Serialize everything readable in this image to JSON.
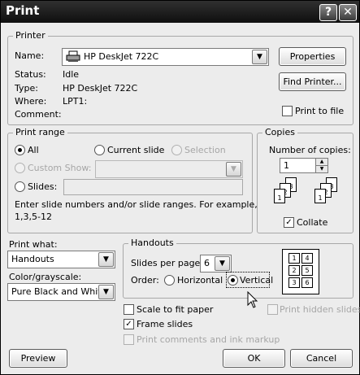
{
  "window": {
    "title": "Print",
    "help_btn": "?",
    "close_btn": "✕"
  },
  "printer": {
    "group_label": "Printer",
    "name_label": "Name:",
    "name_value": "HP DeskJet 722C",
    "properties_btn": "Properties",
    "find_printer_btn": "Find Printer...",
    "status_label": "Status:",
    "status_value": "Idle",
    "type_label": "Type:",
    "type_value": "HP DeskJet 722C",
    "where_label": "Where:",
    "where_value": "LPT1:",
    "comment_label": "Comment:",
    "comment_value": "",
    "print_to_file": "Print to file"
  },
  "print_range": {
    "group_label": "Print range",
    "all": "All",
    "current_slide": "Current slide",
    "selection": "Selection",
    "custom_show": "Custom Show:",
    "slides": "Slides:",
    "hint": "Enter slide numbers and/or slide ranges. For example,",
    "hint_example": "1,3,5-12"
  },
  "copies": {
    "group_label": "Copies",
    "number_label": "Number of copies:",
    "number_value": "1",
    "collate": "Collate",
    "collate_checked": true
  },
  "print_what": {
    "label": "Print what:",
    "value": "Handouts"
  },
  "color": {
    "label": "Color/grayscale:",
    "value": "Pure Black and White"
  },
  "handouts": {
    "group_label": "Handouts",
    "slides_per_page_label": "Slides per page:",
    "slides_per_page_value": "6",
    "order_label": "Order:",
    "horizontal": "Horizontal",
    "vertical": "Vertical",
    "preview_cells": [
      "1",
      "4",
      "2",
      "5",
      "3",
      "6"
    ]
  },
  "options": {
    "scale_to_fit": "Scale to fit paper",
    "frame_slides": "Frame slides",
    "print_comments": "Print comments and ink markup",
    "print_hidden": "Print hidden slides"
  },
  "buttons": {
    "preview": "Preview",
    "ok": "OK",
    "cancel": "Cancel"
  }
}
